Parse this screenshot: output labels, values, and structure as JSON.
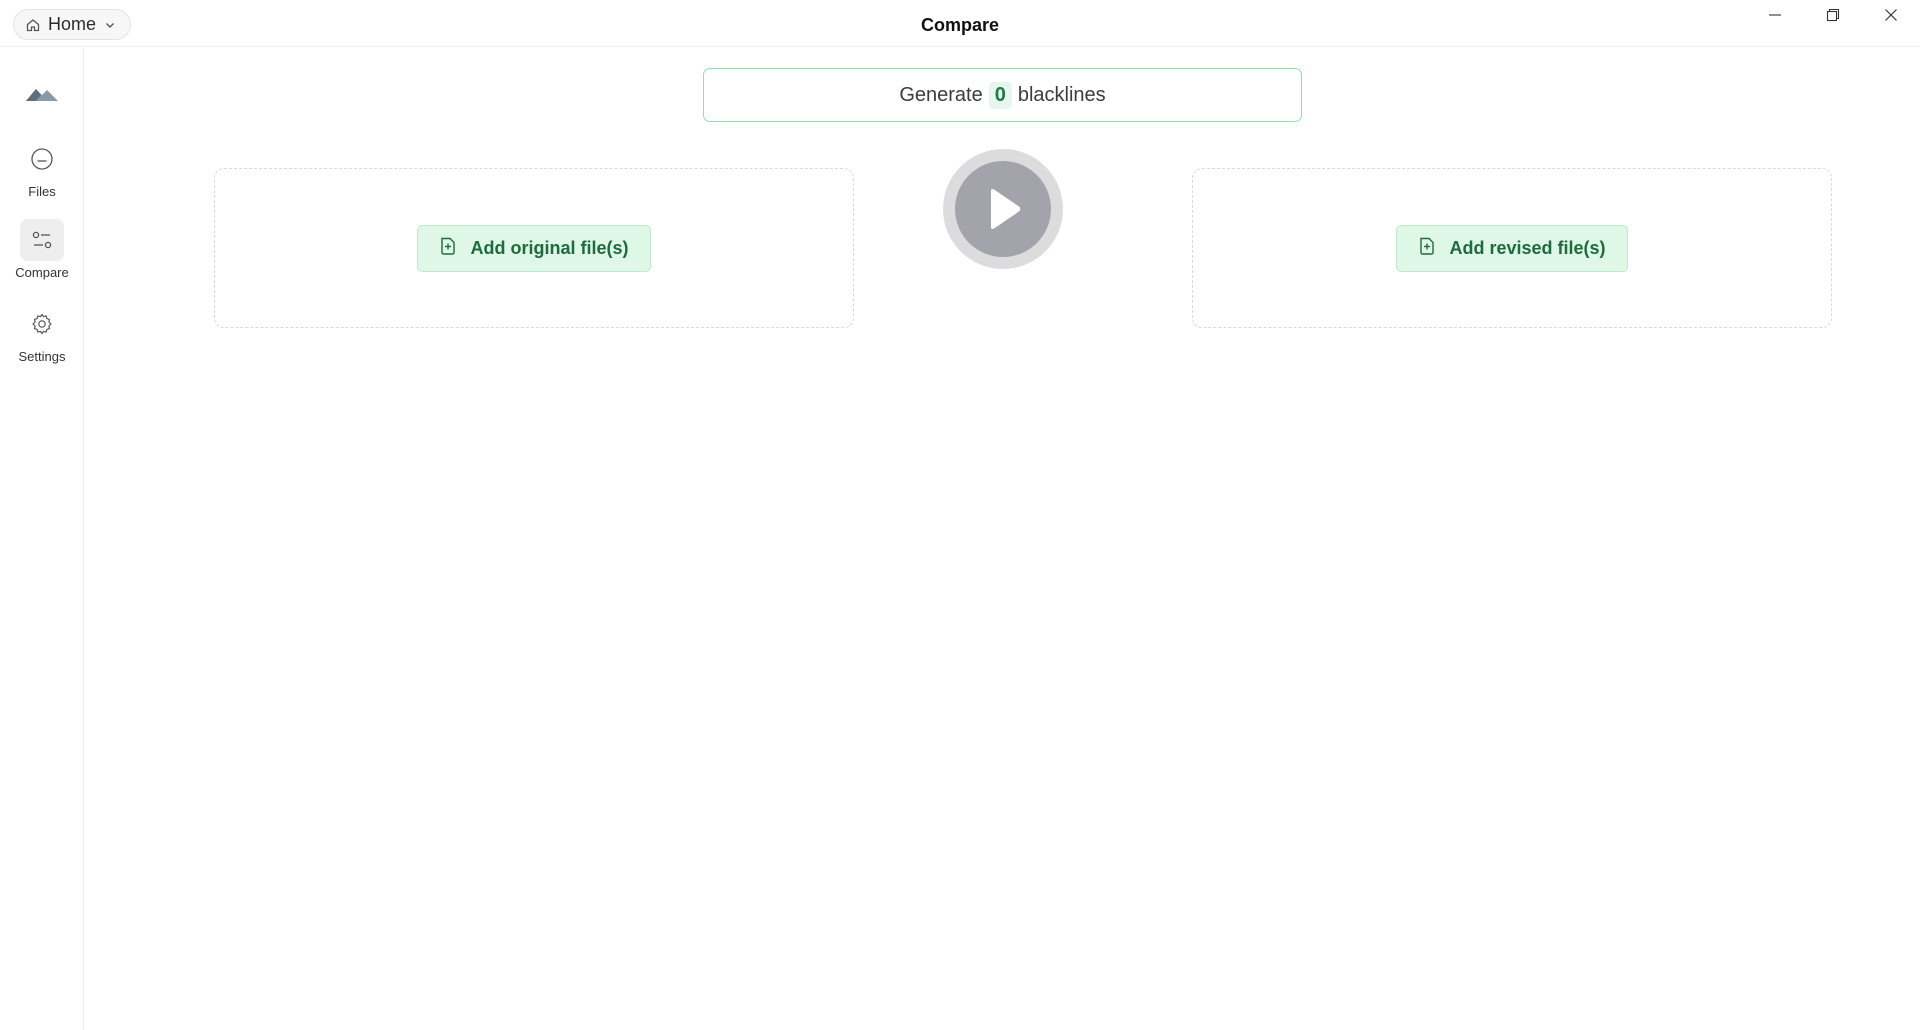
{
  "titlebar": {
    "home_label": "Home",
    "window_title": "Compare"
  },
  "sidebar": {
    "items": [
      {
        "label": "Files",
        "icon": "files-icon",
        "active": false
      },
      {
        "label": "Compare",
        "icon": "compare-icon",
        "active": true
      },
      {
        "label": "Settings",
        "icon": "gear-icon",
        "active": false
      }
    ]
  },
  "main": {
    "generate": {
      "prefix": "Generate",
      "count": "0",
      "suffix": "blacklines"
    },
    "original_button_label": "Add original file(s)",
    "revised_button_label": "Add revised file(s)",
    "run_icon": "play-icon"
  },
  "colors": {
    "accent_green": "#1d6b3f",
    "button_bg": "#dff7e6",
    "generate_border": "#8fe0b0",
    "play_disabled": "#a3a4ab"
  }
}
